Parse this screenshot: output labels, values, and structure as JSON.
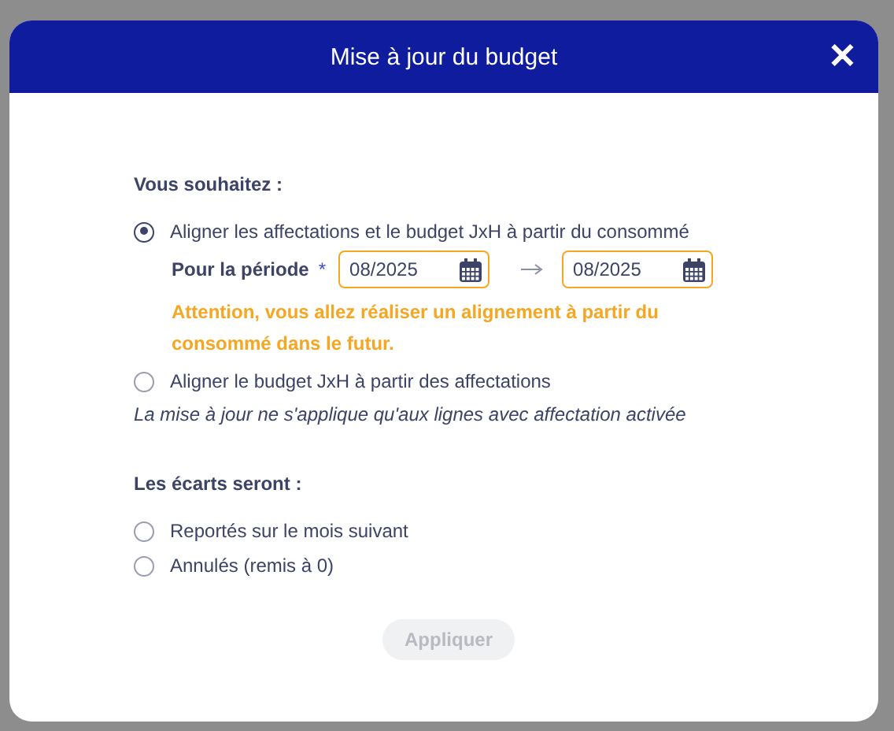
{
  "dialog": {
    "title": "Mise à jour du budget",
    "close": "✕"
  },
  "mode": {
    "label": "Vous souhaitez :",
    "options": [
      {
        "label": "Aligner les affectations et le budget JxH à partir du consommé",
        "selected": true,
        "period": {
          "label": "Pour la période",
          "required": "*",
          "from": "08/2025",
          "to": "08/2025"
        },
        "warning": "Attention, vous allez réaliser un alignement à partir du consommé dans le futur."
      },
      {
        "label": "Aligner le budget JxH à partir des affectations",
        "selected": false
      }
    ],
    "note": "La mise à jour ne s'applique qu'aux lignes avec affectation activée"
  },
  "gaps": {
    "label": "Les écarts seront :",
    "options": [
      {
        "label": "Reportés sur le mois suivant",
        "selected": false
      },
      {
        "label": "Annulés (remis à 0)",
        "selected": false
      }
    ]
  },
  "apply": {
    "label": "Appliquer",
    "disabled": true
  }
}
